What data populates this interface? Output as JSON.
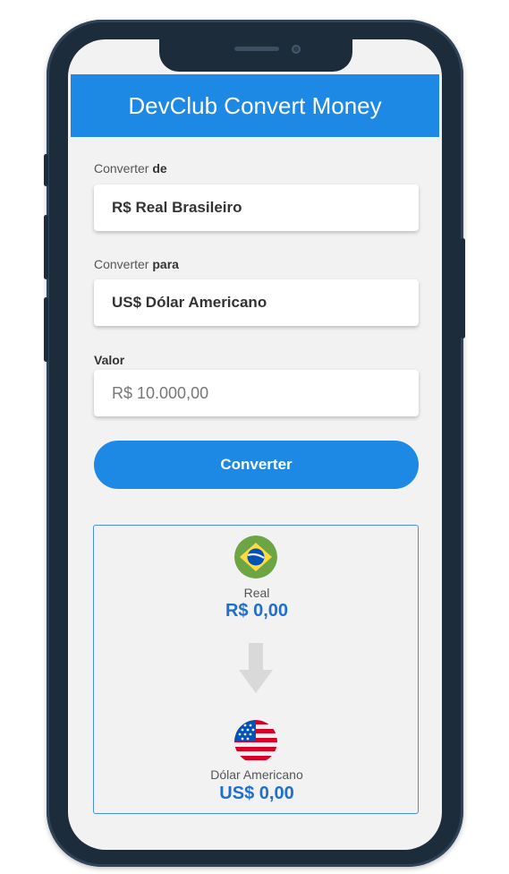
{
  "header": {
    "title": "DevClub Convert Money"
  },
  "form": {
    "from_label_prefix": "Converter ",
    "from_label_bold": "de",
    "from_selected": "R$ Real Brasileiro",
    "to_label_prefix": "Converter ",
    "to_label_bold": "para",
    "to_selected": "US$ Dólar Americano",
    "value_label": "Valor",
    "value_placeholder": "R$ 10.000,00",
    "convert_button": "Converter"
  },
  "result": {
    "from": {
      "name": "Real",
      "value": "R$ 0,00",
      "icon": "brazil-flag-icon"
    },
    "to": {
      "name": "Dólar Americano",
      "value": "US$ 0,00",
      "icon": "usa-flag-icon"
    },
    "arrow_icon": "arrow-down-icon"
  },
  "colors": {
    "primary": "#1e88e5",
    "value_text": "#1e6fd0",
    "result_border": "#4a90d9",
    "screen_bg": "#f2f2f2",
    "phone_frame": "#1c2c3a"
  }
}
